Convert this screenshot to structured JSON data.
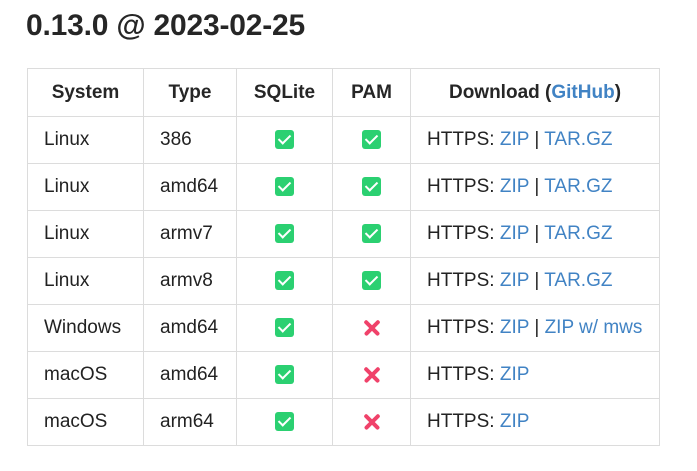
{
  "release": {
    "title": "0.13.0 @ 2023-02-25"
  },
  "table": {
    "headers": {
      "system": "System",
      "type": "Type",
      "sqlite": "SQLite",
      "pam": "PAM",
      "download_prefix": "Download (",
      "download_link": "GitHub",
      "download_suffix": ")"
    },
    "rows": [
      {
        "system": "Linux",
        "type": "386",
        "sqlite": true,
        "pam": true,
        "https_label": "HTTPS:",
        "link1": "ZIP",
        "separator": "|",
        "link2": "TAR.GZ"
      },
      {
        "system": "Linux",
        "type": "amd64",
        "sqlite": true,
        "pam": true,
        "https_label": "HTTPS:",
        "link1": "ZIP",
        "separator": "|",
        "link2": "TAR.GZ"
      },
      {
        "system": "Linux",
        "type": "armv7",
        "sqlite": true,
        "pam": true,
        "https_label": "HTTPS:",
        "link1": "ZIP",
        "separator": "|",
        "link2": "TAR.GZ"
      },
      {
        "system": "Linux",
        "type": "armv8",
        "sqlite": true,
        "pam": true,
        "https_label": "HTTPS:",
        "link1": "ZIP",
        "separator": "|",
        "link2": "TAR.GZ"
      },
      {
        "system": "Windows",
        "type": "amd64",
        "sqlite": true,
        "pam": false,
        "https_label": "HTTPS:",
        "link1": "ZIP",
        "separator": "|",
        "link2": "ZIP w/ mws"
      },
      {
        "system": "macOS",
        "type": "amd64",
        "sqlite": true,
        "pam": false,
        "https_label": "HTTPS:",
        "link1": "ZIP"
      },
      {
        "system": "macOS",
        "type": "arm64",
        "sqlite": true,
        "pam": false,
        "https_label": "HTTPS:",
        "link1": "ZIP"
      }
    ]
  },
  "icons": {
    "supported": "check-icon",
    "unsupported": "cross-icon"
  },
  "colors": {
    "link": "#4183c4",
    "check": "#2bd071",
    "cross": "#f0426a",
    "border": "#dcdcdc",
    "text": "#262626"
  }
}
